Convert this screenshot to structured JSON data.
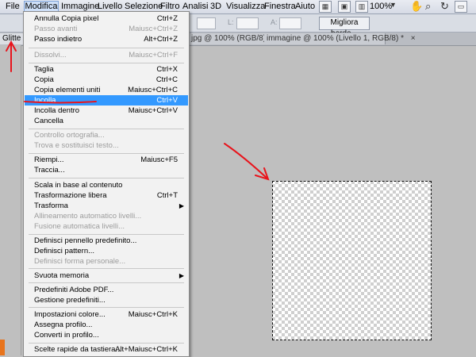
{
  "menubar": {
    "items": [
      "File",
      "Modifica",
      "Immagine",
      "Livello",
      "Selezione",
      "Filtro",
      "Analisi",
      "3D",
      "Visualizza",
      "Finestra",
      "Aiuto"
    ],
    "zoom": "100%"
  },
  "optionsbar": {
    "refine_edge": "Migliora bordo..."
  },
  "tabs": {
    "tab1": "Glitte",
    "tab2": "jpg @ 100% (RGB/8)",
    "tab3": "immagine @ 100% (Livello 1, RGB/8) *",
    "close": "×"
  },
  "menu": {
    "items": [
      {
        "label": "Annulla Copia pixel",
        "shortcut": "Ctrl+Z"
      },
      {
        "label": "Passo avanti",
        "shortcut": "Maiusc+Ctrl+Z"
      },
      {
        "label": "Passo indietro",
        "shortcut": "Alt+Ctrl+Z"
      },
      {
        "label": "Dissolvi...",
        "shortcut": "Maiusc+Ctrl+F"
      },
      {
        "label": "Taglia",
        "shortcut": "Ctrl+X"
      },
      {
        "label": "Copia",
        "shortcut": "Ctrl+C"
      },
      {
        "label": "Copia elementi uniti",
        "shortcut": "Maiusc+Ctrl+C"
      },
      {
        "label": "Incolla",
        "shortcut": "Ctrl+V"
      },
      {
        "label": "Incolla dentro",
        "shortcut": "Maiusc+Ctrl+V"
      },
      {
        "label": "Cancella",
        "shortcut": ""
      },
      {
        "label": "Controllo ortografia...",
        "shortcut": ""
      },
      {
        "label": "Trova e sostituisci testo...",
        "shortcut": ""
      },
      {
        "label": "Riempi...",
        "shortcut": "Maiusc+F5"
      },
      {
        "label": "Traccia...",
        "shortcut": ""
      },
      {
        "label": "Scala in base al contenuto",
        "shortcut": ""
      },
      {
        "label": "Trasformazione libera",
        "shortcut": "Ctrl+T"
      },
      {
        "label": "Trasforma",
        "shortcut": ""
      },
      {
        "label": "Allineamento automatico livelli...",
        "shortcut": ""
      },
      {
        "label": "Fusione automatica livelli...",
        "shortcut": ""
      },
      {
        "label": "Definisci pennello predefinito...",
        "shortcut": ""
      },
      {
        "label": "Definisci pattern...",
        "shortcut": ""
      },
      {
        "label": "Definisci forma personale...",
        "shortcut": ""
      },
      {
        "label": "Svuota memoria",
        "shortcut": ""
      },
      {
        "label": "Predefiniti Adobe PDF...",
        "shortcut": ""
      },
      {
        "label": "Gestione predefiniti...",
        "shortcut": ""
      },
      {
        "label": "Impostazioni colore...",
        "shortcut": "Maiusc+Ctrl+K"
      },
      {
        "label": "Assegna profilo...",
        "shortcut": ""
      },
      {
        "label": "Converti in profilo...",
        "shortcut": ""
      },
      {
        "label": "Scelte rapide da tastiera...",
        "shortcut": "Alt+Maiusc+Ctrl+K"
      }
    ]
  },
  "colors": {
    "highlight": "#3399ff",
    "annotation": "#e8141c"
  }
}
